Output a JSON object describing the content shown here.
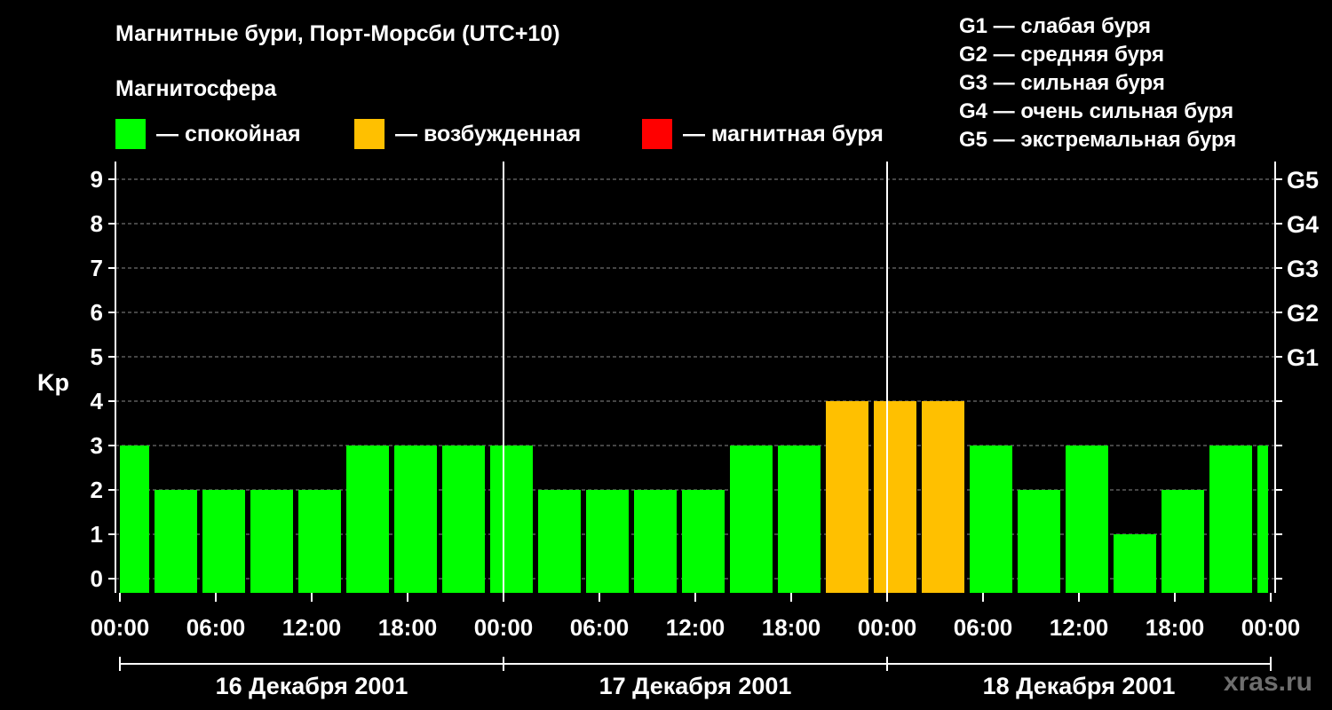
{
  "header": {
    "title": "Магнитные бури, Порт-Морсби (UTC+10)",
    "legend_title": "Магнитосфера"
  },
  "legend": [
    {
      "label": "— спокойная",
      "color": "#00ff00"
    },
    {
      "label": "— возбужденная",
      "color": "#ffc000"
    },
    {
      "label": "— магнитная буря",
      "color": "#ff0000"
    }
  ],
  "g_scale": [
    "G1 — слабая буря",
    "G2 — средняя буря",
    "G3 — сильная буря",
    "G4 — очень сильная буря",
    "G5 — экстремальная буря"
  ],
  "watermark": "xras.ru",
  "chart_data": {
    "type": "bar",
    "ylabel": "Kp",
    "ylim": [
      0,
      9
    ],
    "yticks": [
      "0",
      "1",
      "2",
      "3",
      "4",
      "5",
      "6",
      "7",
      "8",
      "9"
    ],
    "right_ticks": [
      {
        "kp": 5,
        "label": "G1"
      },
      {
        "kp": 6,
        "label": "G2"
      },
      {
        "kp": 7,
        "label": "G3"
      },
      {
        "kp": 8,
        "label": "G4"
      },
      {
        "kp": 9,
        "label": "G5"
      }
    ],
    "grid": true,
    "xtick_labels": [
      "00:00",
      "06:00",
      "12:00",
      "18:00",
      "00:00",
      "06:00",
      "12:00",
      "18:00",
      "00:00",
      "06:00",
      "12:00",
      "18:00",
      "00:00"
    ],
    "days": [
      "16 Декабря 2001",
      "17 Декабря 2001",
      "18 Декабря 2001"
    ],
    "interval_hours": 3,
    "first_bar_offset_hours": -1,
    "values": [
      3,
      2,
      2,
      2,
      2,
      3,
      3,
      3,
      3,
      2,
      2,
      2,
      2,
      3,
      3,
      4,
      4,
      4,
      3,
      2,
      3,
      1,
      2,
      3,
      3
    ],
    "colors": {
      "quiet": "#00ff00",
      "active": "#ffc000",
      "storm": "#ff0000"
    }
  }
}
